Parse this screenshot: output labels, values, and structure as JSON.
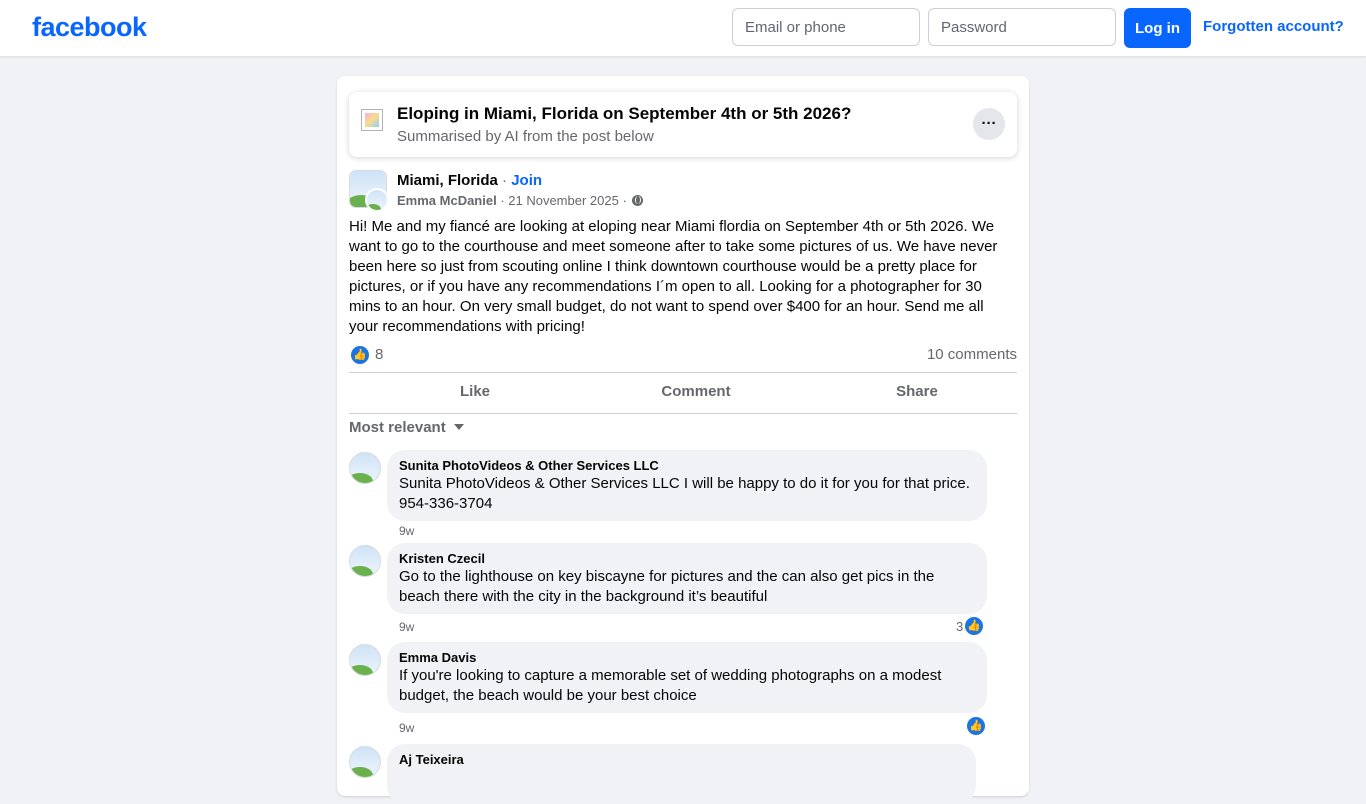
{
  "header": {
    "logo": "facebook",
    "email_placeholder": "Email or phone",
    "password_placeholder": "Password",
    "login_label": "Log in",
    "forgot_label": "Forgotten account?"
  },
  "ai_summary": {
    "title": "Eloping in Miami, Florida on September 4th or 5th 2026?",
    "subtitle": "Summarised by AI from the post below",
    "more_label": "···"
  },
  "post": {
    "group_name": "Miami, Florida",
    "separator": " · ",
    "join_label": "Join",
    "author": "Emma McDaniel",
    "date": " · 21 November 2025 · ",
    "text": "Hi! Me and my fiancé are looking at eloping near Miami flordia on September 4th or 5th 2026. We want to go to the courthouse and meet someone after to take some pictures of us. We have never been here so just from scouting online I think downtown courthouse would be a pretty place for pictures, or if you have any recommendations I´m open to all. Looking for a photographer for 30 mins to an hour. On very small budget, do not want to spend over $400 for an hour. Send me all your recommendations with pricing!",
    "like_count": "8",
    "comments_count": "10 comments",
    "actions": {
      "like": "Like",
      "comment": "Comment",
      "share": "Share"
    },
    "sort_label": "Most relevant"
  },
  "comments": [
    {
      "name": "Sunita PhotoVideos & Other Services LLC",
      "text": "Sunita PhotoVideos & Other Services LLC I will be happy to do it for you for that price. 954-336-3704",
      "time": "9w",
      "likes": ""
    },
    {
      "name": "Kristen Czecil",
      "text": "Go to the lighthouse on key biscayne for pictures and the can also get pics in the beach there with the city in the background it’s beautiful",
      "time": "9w",
      "likes": "3"
    },
    {
      "name": "Emma Davis",
      "text": "If you're looking to capture a memorable set of wedding photographs on a modest budget, the beach would be your best choice",
      "time": "9w",
      "likes": ""
    },
    {
      "name": "Aj Teixeira",
      "text": "",
      "time": "",
      "likes": ""
    }
  ],
  "colors": {
    "brand": "#0866ff",
    "like_blue": "#1b74e4",
    "background": "#f0f2f5"
  },
  "icons": {
    "globe": "globe-icon",
    "like": "thumbs-up-icon",
    "caret": "caret-down-icon"
  }
}
